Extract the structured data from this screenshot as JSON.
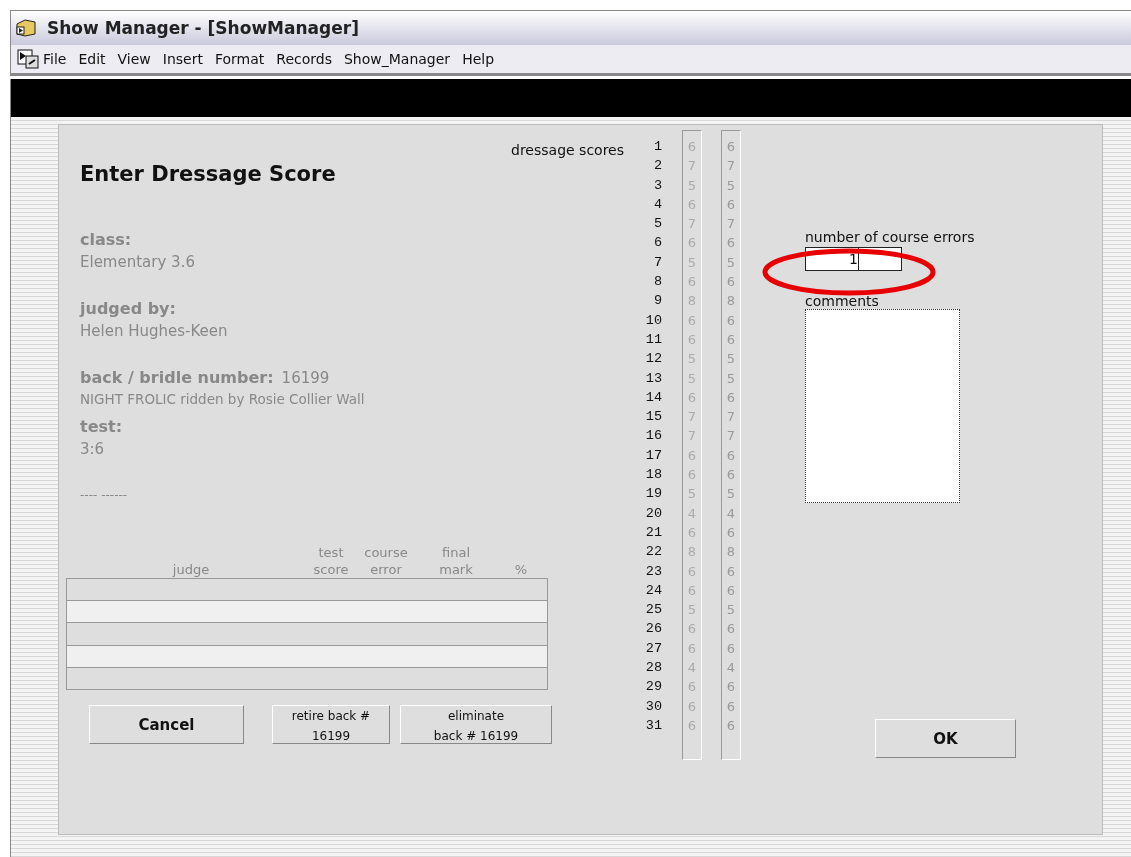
{
  "window": {
    "title": "Show Manager - [ShowManager]"
  },
  "menu": [
    {
      "label": "File"
    },
    {
      "label": "Edit"
    },
    {
      "label": "View"
    },
    {
      "label": "Insert"
    },
    {
      "label": "Format"
    },
    {
      "label": "Records"
    },
    {
      "label": "Show_Manager"
    },
    {
      "label": "Help"
    }
  ],
  "form": {
    "heading": "Enter Dressage Score",
    "fields": [
      {
        "kind": "stacked",
        "label": "class:",
        "value": "Elementary 3.6"
      },
      {
        "kind": "stacked",
        "label": "judged by:",
        "value": "Helen Hughes-Keen"
      },
      {
        "kind": "inline",
        "label": "back / bridle number:",
        "value": "16199",
        "detail": "NIGHT FROLIC ridden by Rosie Collier Wall"
      },
      {
        "kind": "stacked",
        "label": "test:",
        "value": "3:6"
      }
    ],
    "separator_text": "---- ------",
    "results_table": {
      "columns": [
        "judge",
        "test\nscore",
        "course\nerror",
        "final\nmark",
        "%"
      ]
    },
    "buttons": [
      {
        "kind": "primary",
        "label": "Cancel"
      },
      {
        "kind": "small",
        "label": "retire back #\n16199"
      },
      {
        "kind": "small",
        "label": "eliminate\nback # 16199"
      }
    ]
  },
  "scores": {
    "label": "dressage scores",
    "rows": [
      {
        "number": "1",
        "score": "6",
        "score_2": "6"
      },
      {
        "number": "2",
        "score": "7",
        "score_2": "7"
      },
      {
        "number": "3",
        "score": "5",
        "score_2": "5"
      },
      {
        "number": "4",
        "score": "6",
        "score_2": "6"
      },
      {
        "number": "5",
        "score": "7",
        "score_2": "7"
      },
      {
        "number": "6",
        "score": "6",
        "score_2": "6"
      },
      {
        "number": "7",
        "score": "5",
        "score_2": "5"
      },
      {
        "number": "8",
        "score": "6",
        "score_2": "6"
      },
      {
        "number": "9",
        "score": "8",
        "score_2": "8"
      },
      {
        "number": "10",
        "score": "6",
        "score_2": "6"
      },
      {
        "number": "11",
        "score": "6",
        "score_2": "6"
      },
      {
        "number": "12",
        "score": "5",
        "score_2": "5"
      },
      {
        "number": "13",
        "score": "5",
        "score_2": "5"
      },
      {
        "number": "14",
        "score": "6",
        "score_2": "6"
      },
      {
        "number": "15",
        "score": "7",
        "score_2": "7"
      },
      {
        "number": "16",
        "score": "7",
        "score_2": "7"
      },
      {
        "number": "17",
        "score": "6",
        "score_2": "6"
      },
      {
        "number": "18",
        "score": "6",
        "score_2": "6"
      },
      {
        "number": "19",
        "score": "5",
        "score_2": "5"
      },
      {
        "number": "20",
        "score": "4",
        "score_2": "4"
      },
      {
        "number": "21",
        "score": "6",
        "score_2": "6"
      },
      {
        "number": "22",
        "score": "8",
        "score_2": "8"
      },
      {
        "number": "23",
        "score": "6",
        "score_2": "6"
      },
      {
        "number": "24",
        "score": "6",
        "score_2": "6"
      },
      {
        "number": "25",
        "score": "5",
        "score_2": "5"
      },
      {
        "number": "26",
        "score": "6",
        "score_2": "6"
      },
      {
        "number": "27",
        "score": "6",
        "score_2": "6"
      },
      {
        "number": "28",
        "score": "4",
        "score_2": "4"
      },
      {
        "number": "29",
        "score": "6",
        "score_2": "6"
      },
      {
        "number": "30",
        "score": "6",
        "score_2": "6"
      },
      {
        "number": "31",
        "score": "6",
        "score_2": "6"
      }
    ]
  },
  "course_errors": {
    "label": "number of course errors",
    "value": "1"
  },
  "comments": {
    "label": "comments"
  },
  "ok_button": {
    "label": "OK"
  }
}
